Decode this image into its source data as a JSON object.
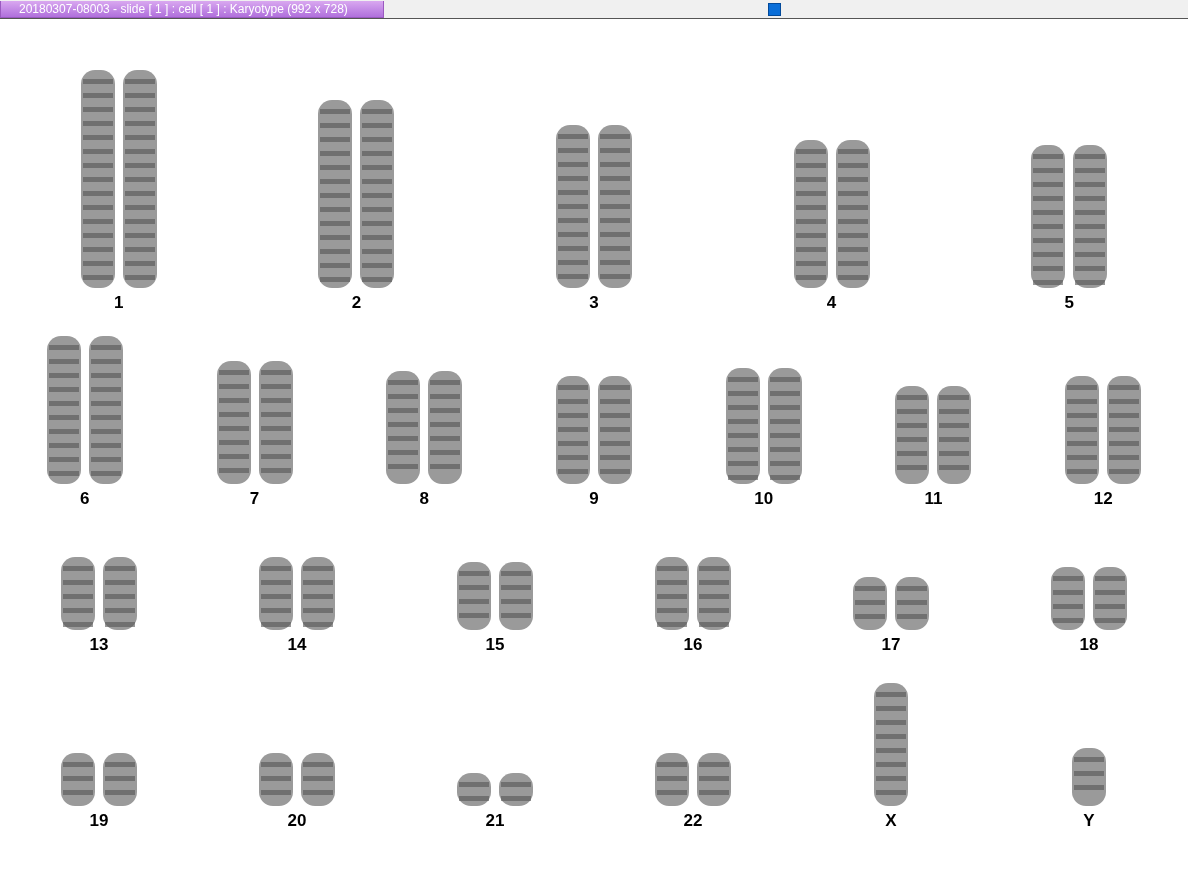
{
  "window": {
    "title": "20180307-08003 - slide [ 1 ] : cell [ 1 ] : Karyotype  (992 x 728)"
  },
  "rows": [
    {
      "chromosomes": [
        {
          "label": "1",
          "kind": "pair"
        },
        {
          "label": "2",
          "kind": "pair"
        },
        {
          "label": "3",
          "kind": "pair"
        },
        {
          "label": "4",
          "kind": "pair"
        },
        {
          "label": "5",
          "kind": "pair"
        }
      ]
    },
    {
      "chromosomes": [
        {
          "label": "6",
          "kind": "pair"
        },
        {
          "label": "7",
          "kind": "pair"
        },
        {
          "label": "8",
          "kind": "pair"
        },
        {
          "label": "9",
          "kind": "pair"
        },
        {
          "label": "10",
          "kind": "pair"
        },
        {
          "label": "11",
          "kind": "pair"
        },
        {
          "label": "12",
          "kind": "pair"
        }
      ]
    },
    {
      "chromosomes": [
        {
          "label": "13",
          "kind": "pair"
        },
        {
          "label": "14",
          "kind": "pair"
        },
        {
          "label": "15",
          "kind": "pair"
        },
        {
          "label": "16",
          "kind": "pair"
        },
        {
          "label": "17",
          "kind": "pair"
        },
        {
          "label": "18",
          "kind": "pair"
        }
      ]
    },
    {
      "chromosomes": [
        {
          "label": "19",
          "kind": "pair"
        },
        {
          "label": "20",
          "kind": "pair"
        },
        {
          "label": "21",
          "kind": "pair"
        },
        {
          "label": "22",
          "kind": "pair"
        },
        {
          "label": "X",
          "kind": "single"
        },
        {
          "label": "Y",
          "kind": "single"
        }
      ]
    }
  ]
}
